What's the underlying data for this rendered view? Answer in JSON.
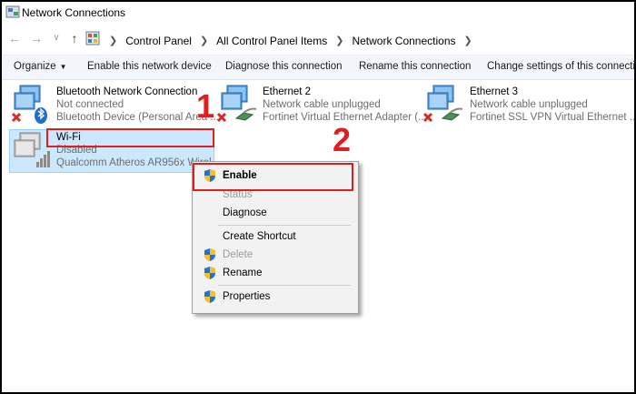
{
  "window": {
    "title": "Network Connections"
  },
  "address_bar": {
    "breadcrumb": [
      "Control Panel",
      "All Control Panel Items",
      "Network Connections"
    ]
  },
  "toolbar": {
    "organize": "Organize",
    "enable": "Enable this network device",
    "diagnose": "Diagnose this connection",
    "rename": "Rename this connection",
    "change_settings": "Change settings of this connection"
  },
  "connections": [
    {
      "name": "Bluetooth Network Connection",
      "status": "Not connected",
      "device": "Bluetooth Device (Personal Area ...",
      "icon": "bluetooth-adapter-icon"
    },
    {
      "name": "Ethernet 2",
      "status": "Network cable unplugged",
      "device": "Fortinet Virtual Ethernet Adapter (...",
      "icon": "ethernet-adapter-icon"
    },
    {
      "name": "Ethernet 3",
      "status": "Network cable unplugged",
      "device": "Fortinet SSL VPN Virtual Ethernet ...",
      "icon": "ethernet-adapter-icon"
    },
    {
      "name": "Wi-Fi",
      "status": "Disabled",
      "device": "Qualcomm Atheros AR956x Wirel",
      "icon": "wifi-adapter-icon"
    }
  ],
  "context_menu": {
    "enable": "Enable",
    "status": "Status",
    "diagnose": "Diagnose",
    "create_shortcut": "Create Shortcut",
    "delete": "Delete",
    "rename": "Rename",
    "properties": "Properties"
  },
  "annotations": {
    "step1": "1",
    "step2": "2",
    "color": "#e11d1d"
  },
  "colors": {
    "selection": "#cce8ff",
    "toolbar": "#f2f6fb",
    "menu": "#f2f2f2"
  }
}
